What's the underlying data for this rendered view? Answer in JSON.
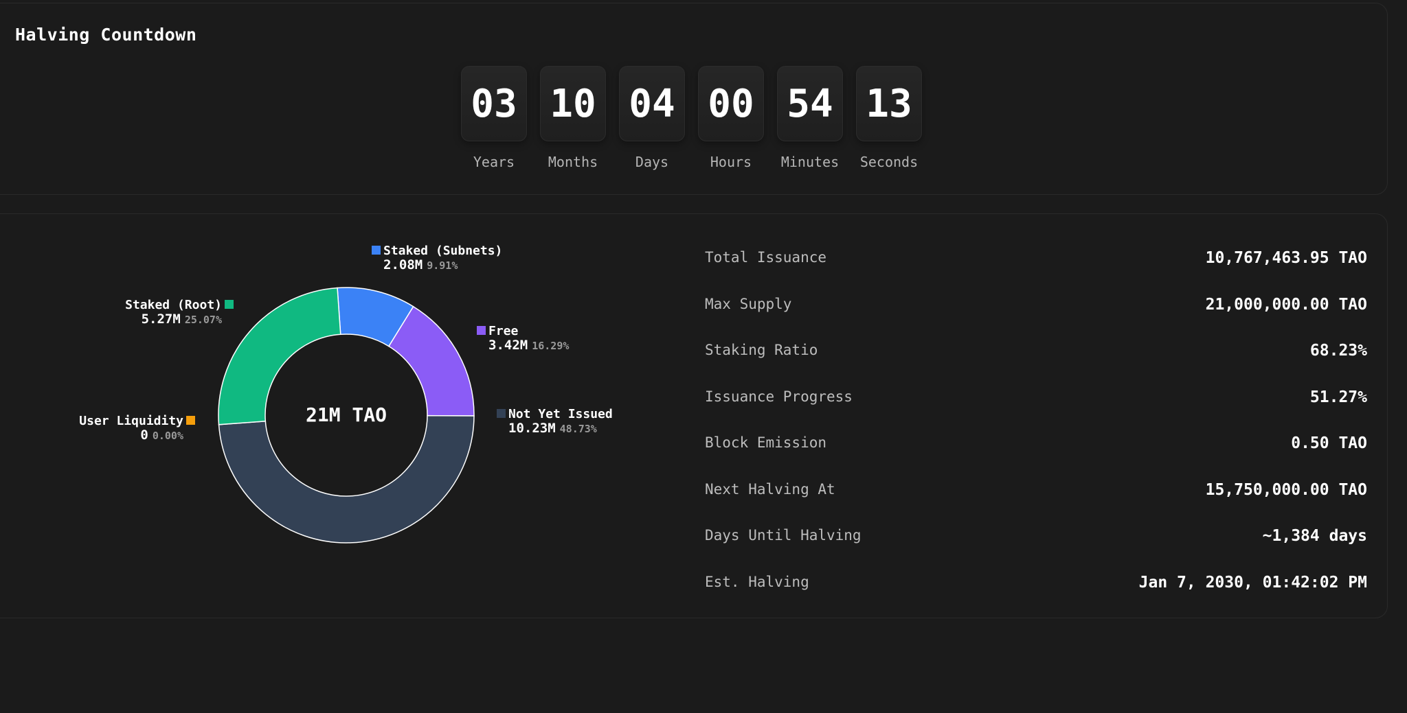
{
  "countdown": {
    "title": "Halving Countdown",
    "units": [
      {
        "value": "03",
        "label": "Years"
      },
      {
        "value": "10",
        "label": "Months"
      },
      {
        "value": "04",
        "label": "Days"
      },
      {
        "value": "00",
        "label": "Hours"
      },
      {
        "value": "54",
        "label": "Minutes"
      },
      {
        "value": "13",
        "label": "Seconds"
      }
    ]
  },
  "supply_chart": {
    "center_label": "21M TAO",
    "segments": [
      {
        "name": "Staked (Subnets)",
        "value": "2.08M",
        "percent": "9.91%",
        "color": "#3b82f6"
      },
      {
        "name": "Free",
        "value": "3.42M",
        "percent": "16.29%",
        "color": "#8b5cf6"
      },
      {
        "name": "Not Yet Issued",
        "value": "10.23M",
        "percent": "48.73%",
        "color": "#334155"
      },
      {
        "name": "User Liquidity",
        "value": "0",
        "percent": "0.00%",
        "color": "#f59e0b"
      },
      {
        "name": "Staked (Root)",
        "value": "5.27M",
        "percent": "25.07%",
        "color": "#10b981"
      }
    ]
  },
  "chart_data": {
    "type": "pie",
    "categories": [
      "Staked (Subnets)",
      "Free",
      "Not Yet Issued",
      "User Liquidity",
      "Staked (Root)"
    ],
    "values": [
      9.91,
      16.29,
      48.73,
      0.0,
      25.07
    ],
    "amounts": [
      "2.08M",
      "3.42M",
      "10.23M",
      "0",
      "5.27M"
    ],
    "colors": [
      "#3b82f6",
      "#8b5cf6",
      "#334155",
      "#f59e0b",
      "#10b981"
    ],
    "title": "",
    "center_label": "21M TAO"
  },
  "stats": [
    {
      "label": "Total Issuance",
      "value": "10,767,463.95 TAO"
    },
    {
      "label": "Max Supply",
      "value": "21,000,000.00 TAO"
    },
    {
      "label": "Staking Ratio",
      "value": "68.23%"
    },
    {
      "label": "Issuance Progress",
      "value": "51.27%"
    },
    {
      "label": "Block Emission",
      "value": "0.50 TAO"
    },
    {
      "label": "Next Halving At",
      "value": "15,750,000.00 TAO"
    },
    {
      "label": "Days Until Halving",
      "value": "~1,384 days"
    },
    {
      "label": "Est. Halving",
      "value": "Jan 7, 2030, 01:42:02 PM"
    }
  ]
}
